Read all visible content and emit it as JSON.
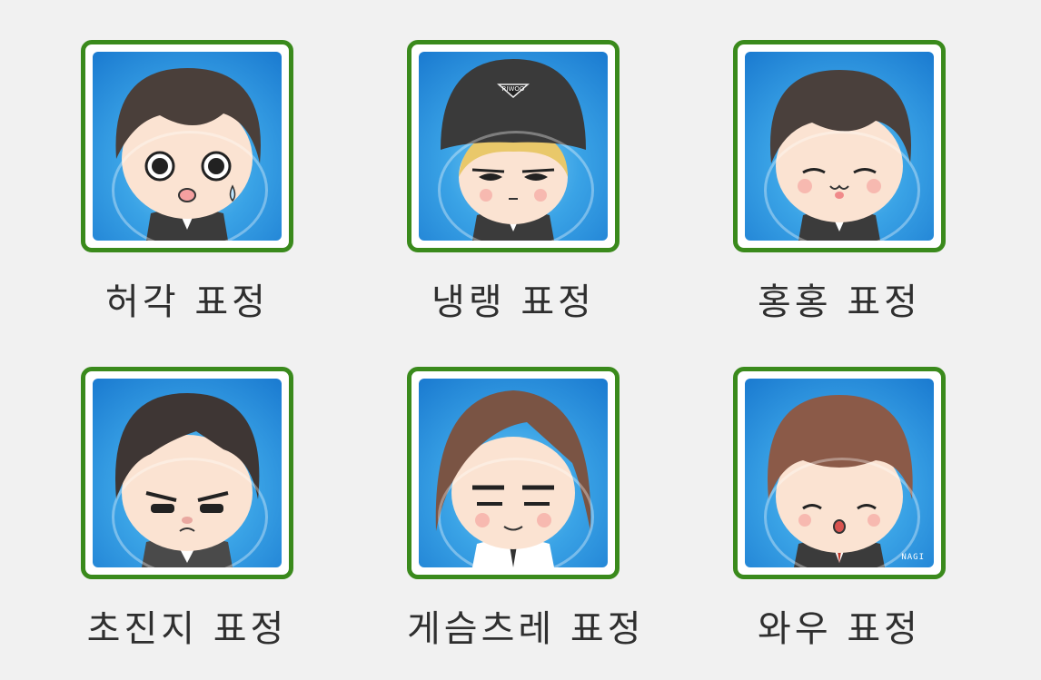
{
  "cards": [
    {
      "label": "허각 표정",
      "hair": "#4a3f3a",
      "skin": "#fbe3d2",
      "hat": false
    },
    {
      "label": "냉랭 표정",
      "hair": "#e9c86a",
      "skin": "#fbe3d2",
      "hat": true,
      "hat_text": "RIWOO"
    },
    {
      "label": "홍홍 표정",
      "hair": "#4a403c",
      "skin": "#fbe3d2",
      "hat": false
    },
    {
      "label": "초진지 표정",
      "hair": "#3e3634",
      "skin": "#fbe3d2",
      "hat": false
    },
    {
      "label": "게슴츠레 표정",
      "hair": "#7a5444",
      "skin": "#fbe3d2",
      "hat": false
    },
    {
      "label": "와우 표정",
      "hair": "#8b5a48",
      "skin": "#fbe3d2",
      "hat": false,
      "signature": "NAGI"
    }
  ],
  "colors": {
    "frame": "#3a8a1c",
    "background": "#f1f1f1",
    "sky": "#3aa3e6"
  }
}
